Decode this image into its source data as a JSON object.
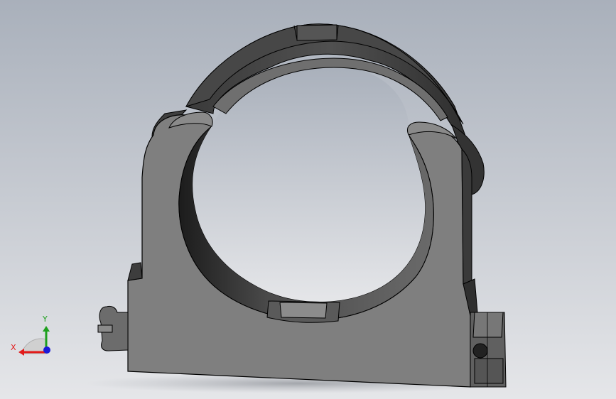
{
  "viewport": {
    "background_top": "#a9b0bb",
    "background_bottom": "#e5e6e9"
  },
  "model": {
    "face_front": "#7f7f7f",
    "face_side": "#5a5a5a",
    "face_dark": "#3b3b3b",
    "face_light": "#9a9a9a",
    "edge": "#000000"
  },
  "triad": {
    "x_label": "X",
    "y_label": "Y",
    "x_color": "#e21a1a",
    "y_color": "#1ea01e",
    "z_color": "#1a1ad8",
    "x_icon": "x-axis-arrow-icon",
    "y_icon": "y-axis-arrow-icon",
    "z_icon": "z-axis-dot-icon"
  }
}
